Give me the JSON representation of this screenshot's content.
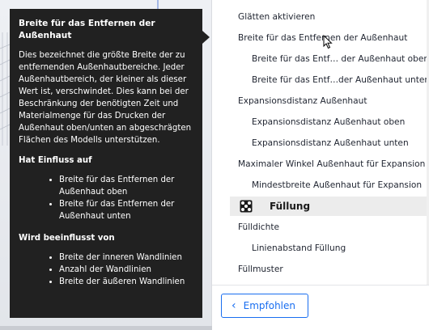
{
  "tooltip": {
    "title": "Breite für das Entfernen der Außenhaut",
    "description": "Dies bezeichnet die größte Breite der zu entfernenden Außenhautbereiche. Jeder Außenhautbereich, der kleiner als dieser Wert ist, verschwindet. Dies kann bei der Beschränkung der benötigten Zeit und Materialmenge für das Drucken der Außenhaut oben/unten an abgeschrägten Flächen des Modells unterstützen.",
    "affects_heading": "Hat Einfluss auf",
    "affects": [
      "Breite für das Entfernen der Außenhaut oben",
      "Breite für das Entfernen der Außenhaut unten"
    ],
    "affected_by_heading": "Wird beeinflusst von",
    "affected_by": [
      "Breite der inneren Wandlinien",
      "Anzahl der Wandlinien",
      "Breite der äußeren Wandlinien"
    ]
  },
  "settings": [
    {
      "label": "Glätten aktivieren",
      "level": 0
    },
    {
      "label": "Breite für das Entfernen der Außenhaut",
      "level": 0
    },
    {
      "label": "Breite für das Entf… der Außenhaut oben",
      "level": 1
    },
    {
      "label": "Breite für das Entf…der Außenhaut unten",
      "level": 1
    },
    {
      "label": "Expansionsdistanz Außenhaut",
      "level": 0
    },
    {
      "label": "Expansionsdistanz Außenhaut oben",
      "level": 1
    },
    {
      "label": "Expansionsdistanz Außenhaut unten",
      "level": 1
    },
    {
      "label": "Maximaler Winkel Außenhaut für Expansion",
      "level": 0
    },
    {
      "label": "Mindestbreite Außenhaut für Expansion",
      "level": 1
    }
  ],
  "category": {
    "label": "Füllung",
    "icon": "infill-icon"
  },
  "settings_after": [
    {
      "label": "Fülldichte",
      "level": 0
    },
    {
      "label": "Linienabstand Füllung",
      "level": 1
    },
    {
      "label": "Füllmuster",
      "level": 0
    }
  ],
  "footer": {
    "recommended_label": "Empfohlen",
    "icon": "chevron-left-icon"
  },
  "colors": {
    "accent": "#196ef0",
    "tooltip_bg": "#212121",
    "category_bg": "#ececec"
  }
}
